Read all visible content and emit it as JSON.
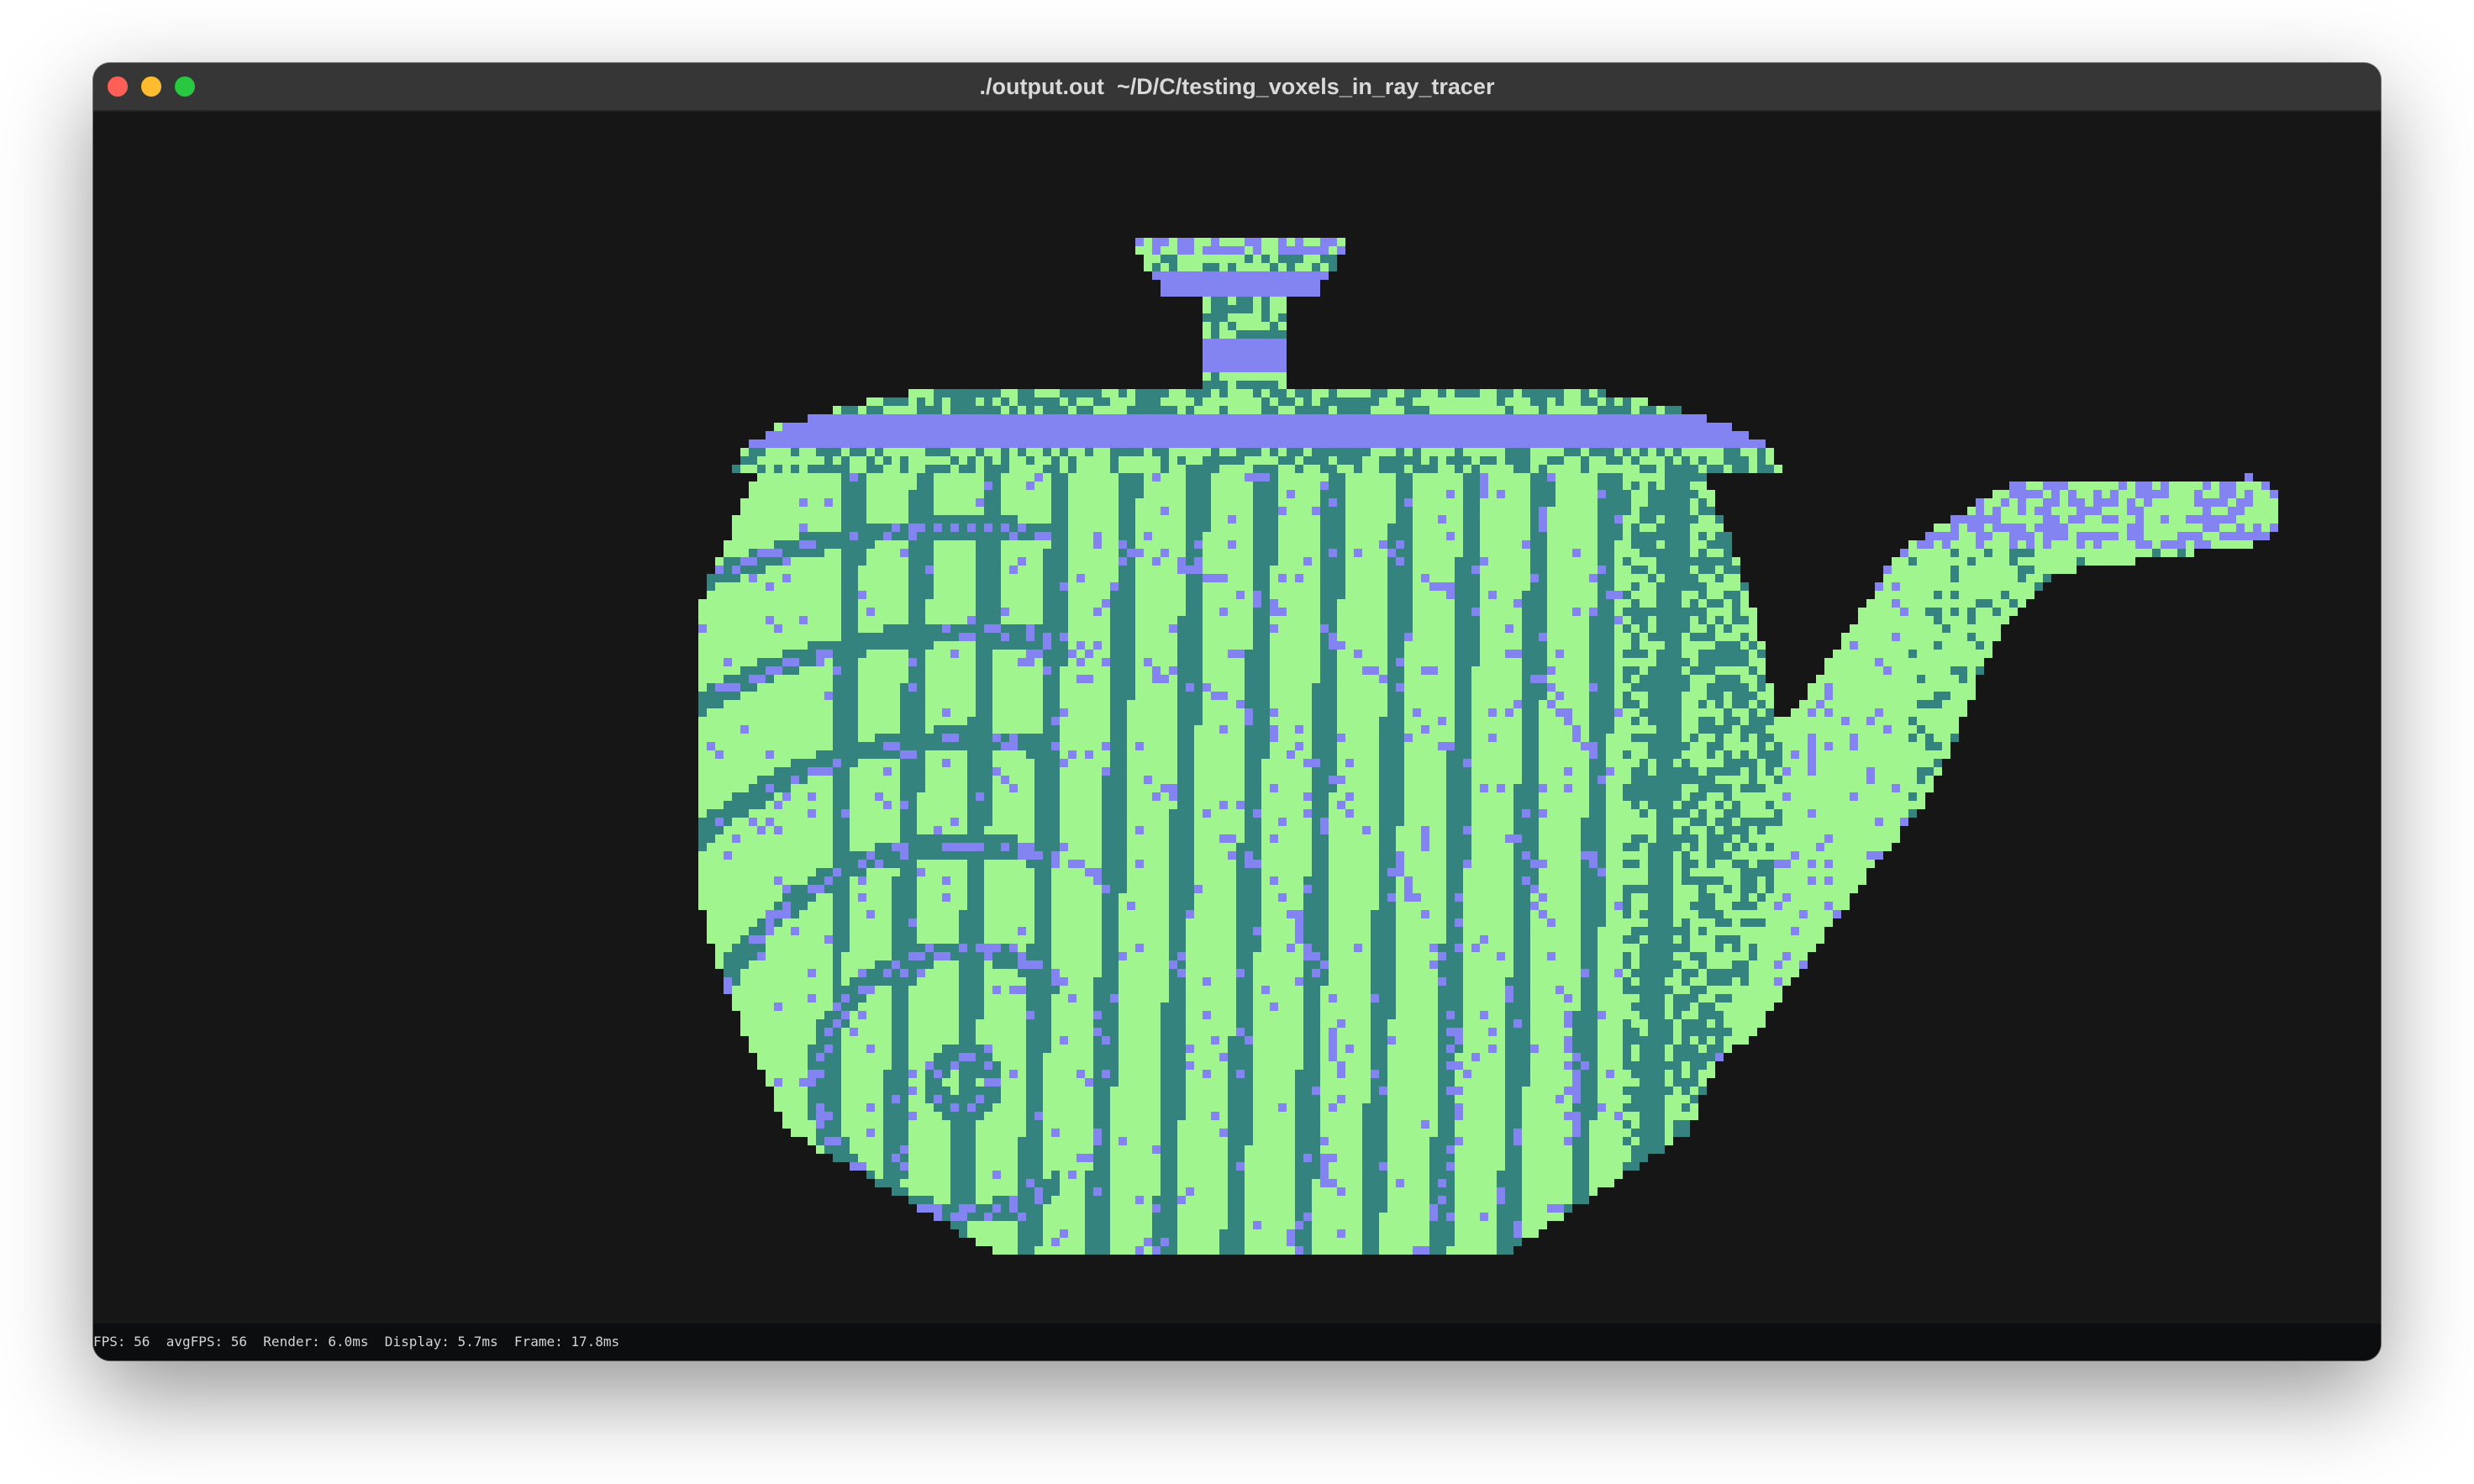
{
  "window": {
    "title": "./output.out  ~/D/C/testing_voxels_in_ray_tracer"
  },
  "scene": {
    "subject": "voxel teapot",
    "colors": {
      "background": "#161616",
      "lit": "#a0f58f",
      "shadow": "#35837e",
      "top": "#8483f2"
    }
  },
  "status": {
    "fps": "FPS: 56",
    "avg_fps": "avgFPS: 56",
    "render": "Render: 6.0ms",
    "display": "Display: 5.7ms",
    "frame": "Frame: 17.8ms"
  }
}
